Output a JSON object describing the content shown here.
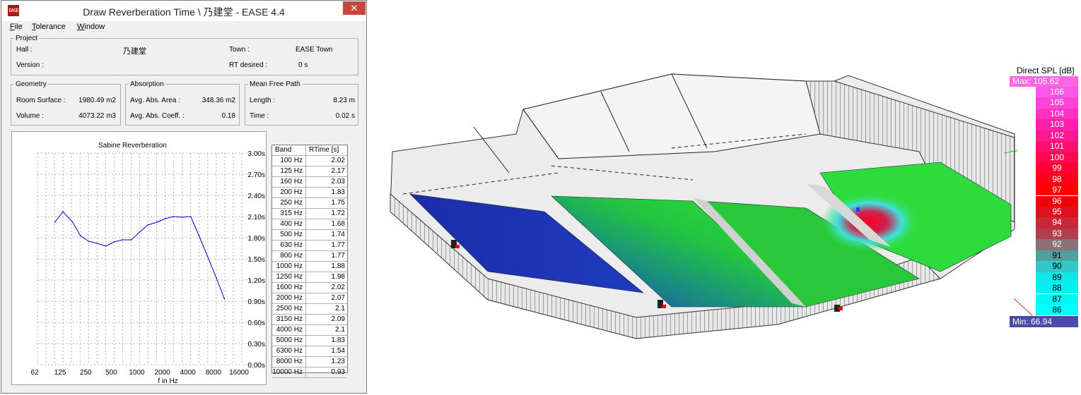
{
  "window": {
    "title": "Draw Reverberation Time \\ 乃建堂 - EASE 4.4",
    "icon_text": "EASE",
    "close_label": "✕"
  },
  "menu": [
    {
      "underline": "F",
      "rest": "ile"
    },
    {
      "underline": "T",
      "rest": "olerance"
    },
    {
      "underline": "W",
      "rest": "indow"
    }
  ],
  "project": {
    "legend": "Project",
    "hall_label": "Hall :",
    "hall_value": "乃建堂",
    "town_label": "Town :",
    "town_value": "EASE Town",
    "version_label": "Version :",
    "version_value": "",
    "rt_label": "RT desired :",
    "rt_value": "0 s"
  },
  "geometry": {
    "legend": "Geometry",
    "surface_label": "Room Surface :",
    "surface_value": "1980.49 m2",
    "volume_label": "Volume :",
    "volume_value": "4073.22 m3"
  },
  "absorption": {
    "legend": "Absorption",
    "area_label": "Avg. Abs. Area :",
    "area_value": "348.36 m2",
    "coeff_label": "Avg. Abs. Coeff. :",
    "coeff_value": "0.18"
  },
  "mfp": {
    "legend": "Mean Free Path",
    "length_label": "Length :",
    "length_value": "8.23 m",
    "time_label": "Time :",
    "time_value": "0.02 s"
  },
  "chart_data": {
    "type": "line",
    "title": "Sabine Reverberation",
    "xlabel": "f in Hz",
    "ylabel": "",
    "x_tick_labels": [
      "62",
      "125",
      "250",
      "500",
      "1000",
      "2000",
      "4000",
      "8000",
      "16000"
    ],
    "y_tick_labels": [
      "3.00s",
      "2.70s",
      "2.40s",
      "2.10s",
      "1.80s",
      "1.50s",
      "1.20s",
      "0.90s",
      "0.60s",
      "0.30s",
      "0.00s"
    ],
    "ylim": [
      0,
      3.0
    ],
    "x_scale": "log",
    "grid": true,
    "series": [
      {
        "color": "#0000cc",
        "x": [
          100,
          125,
          160,
          200,
          250,
          315,
          400,
          500,
          630,
          800,
          1000,
          1250,
          1600,
          2000,
          2500,
          3150,
          4000,
          5000,
          6300,
          8000,
          10000
        ],
        "values": [
          2.02,
          2.17,
          2.03,
          1.83,
          1.75,
          1.72,
          1.68,
          1.74,
          1.77,
          1.77,
          1.88,
          1.98,
          2.02,
          2.07,
          2.1,
          2.09,
          2.1,
          1.83,
          1.54,
          1.23,
          0.93
        ]
      }
    ]
  },
  "table": {
    "headers": [
      "Band",
      "RTime [s]"
    ],
    "rows": [
      [
        "100 Hz",
        "2.02"
      ],
      [
        "125 Hz",
        "2.17"
      ],
      [
        "160 Hz",
        "2.03"
      ],
      [
        "200 Hz",
        "1.83"
      ],
      [
        "250 Hz",
        "1.75"
      ],
      [
        "315 Hz",
        "1.72"
      ],
      [
        "400 Hz",
        "1.68"
      ],
      [
        "500 Hz",
        "1.74"
      ],
      [
        "630 Hz",
        "1.77"
      ],
      [
        "800 Hz",
        "1.77"
      ],
      [
        "1000 Hz",
        "1.88"
      ],
      [
        "1250 Hz",
        "1.98"
      ],
      [
        "1600 Hz",
        "2.02"
      ],
      [
        "2000 Hz",
        "2.07"
      ],
      [
        "2500 Hz",
        "2.1"
      ],
      [
        "3150 Hz",
        "2.09"
      ],
      [
        "4000 Hz",
        "2.1"
      ],
      [
        "5000 Hz",
        "1.83"
      ],
      [
        "6300 Hz",
        "1.54"
      ],
      [
        "8000 Hz",
        "1.23"
      ],
      [
        "10000 Hz",
        "0.93"
      ]
    ]
  },
  "spl_legend": {
    "title": "Direct SPL [dB]",
    "max_label": "Max:  105.62",
    "min_label": "Min:  66.94",
    "levels": [
      {
        "value": "106",
        "color": "#ff55e8",
        "text": "#ffffff"
      },
      {
        "value": "105",
        "color": "#ff44d8",
        "text": "#ffffff"
      },
      {
        "value": "104",
        "color": "#ff33c0",
        "text": "#ffffff"
      },
      {
        "value": "103",
        "color": "#ff22a8",
        "text": "#ffffff"
      },
      {
        "value": "102",
        "color": "#ff1890",
        "text": "#ffffff"
      },
      {
        "value": "101",
        "color": "#ff1070",
        "text": "#ffffff"
      },
      {
        "value": "100",
        "color": "#ff0850",
        "text": "#ffffff"
      },
      {
        "value": "99",
        "color": "#ff0030",
        "text": "#ffffff"
      },
      {
        "value": "98",
        "color": "#ff0018",
        "text": "#ffffff"
      },
      {
        "value": "97",
        "color": "#ff0000",
        "text": "#ffffff"
      },
      {
        "value": "96",
        "color": "#f00008",
        "text": "#ffffff"
      },
      {
        "value": "95",
        "color": "#e01020",
        "text": "#ffffff"
      },
      {
        "value": "94",
        "color": "#c82838",
        "text": "#ffffff"
      },
      {
        "value": "93",
        "color": "#b04050",
        "text": "#ffffff"
      },
      {
        "value": "92",
        "color": "#8a7078",
        "text": "#ffffff"
      },
      {
        "value": "91",
        "color": "#50a0a0",
        "text": "#000000"
      },
      {
        "value": "90",
        "color": "#30c8c8",
        "text": "#000000"
      },
      {
        "value": "89",
        "color": "#10e8e8",
        "text": "#000000"
      },
      {
        "value": "88",
        "color": "#00f0f0",
        "text": "#000000"
      },
      {
        "value": "87",
        "color": "#00f8f8",
        "text": "#000000"
      },
      {
        "value": "86",
        "color": "#00ffff",
        "text": "#000000"
      }
    ]
  }
}
